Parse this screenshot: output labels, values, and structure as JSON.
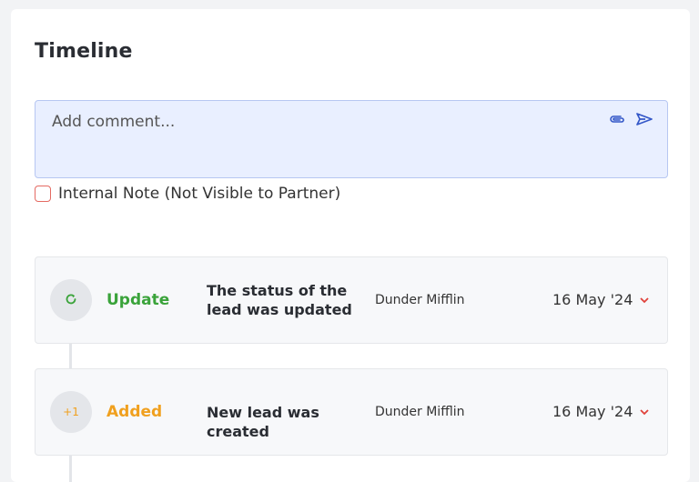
{
  "timeline": {
    "title": "Timeline",
    "comment": {
      "placeholder": "Add comment...",
      "value": "",
      "attach_icon": "paperclip-icon",
      "send_icon": "send-icon"
    },
    "internal_note": {
      "label": "Internal Note (Not Visible to Partner)",
      "checked": false
    },
    "entries": [
      {
        "icon": "refresh-icon",
        "type": "Update",
        "type_color": "#3aa33a",
        "description": "The status of the lead was updated",
        "company": "Dunder Mifflin",
        "date": "16 May '24"
      },
      {
        "badge_text": "+1",
        "type": "Added",
        "type_color": "#f0a01e",
        "description": "New lead was created",
        "company": "Dunder Mifflin",
        "date": "16 May '24"
      }
    ]
  },
  "colors": {
    "accent_blue": "#3558c8",
    "chevron_red": "#e0413a"
  }
}
